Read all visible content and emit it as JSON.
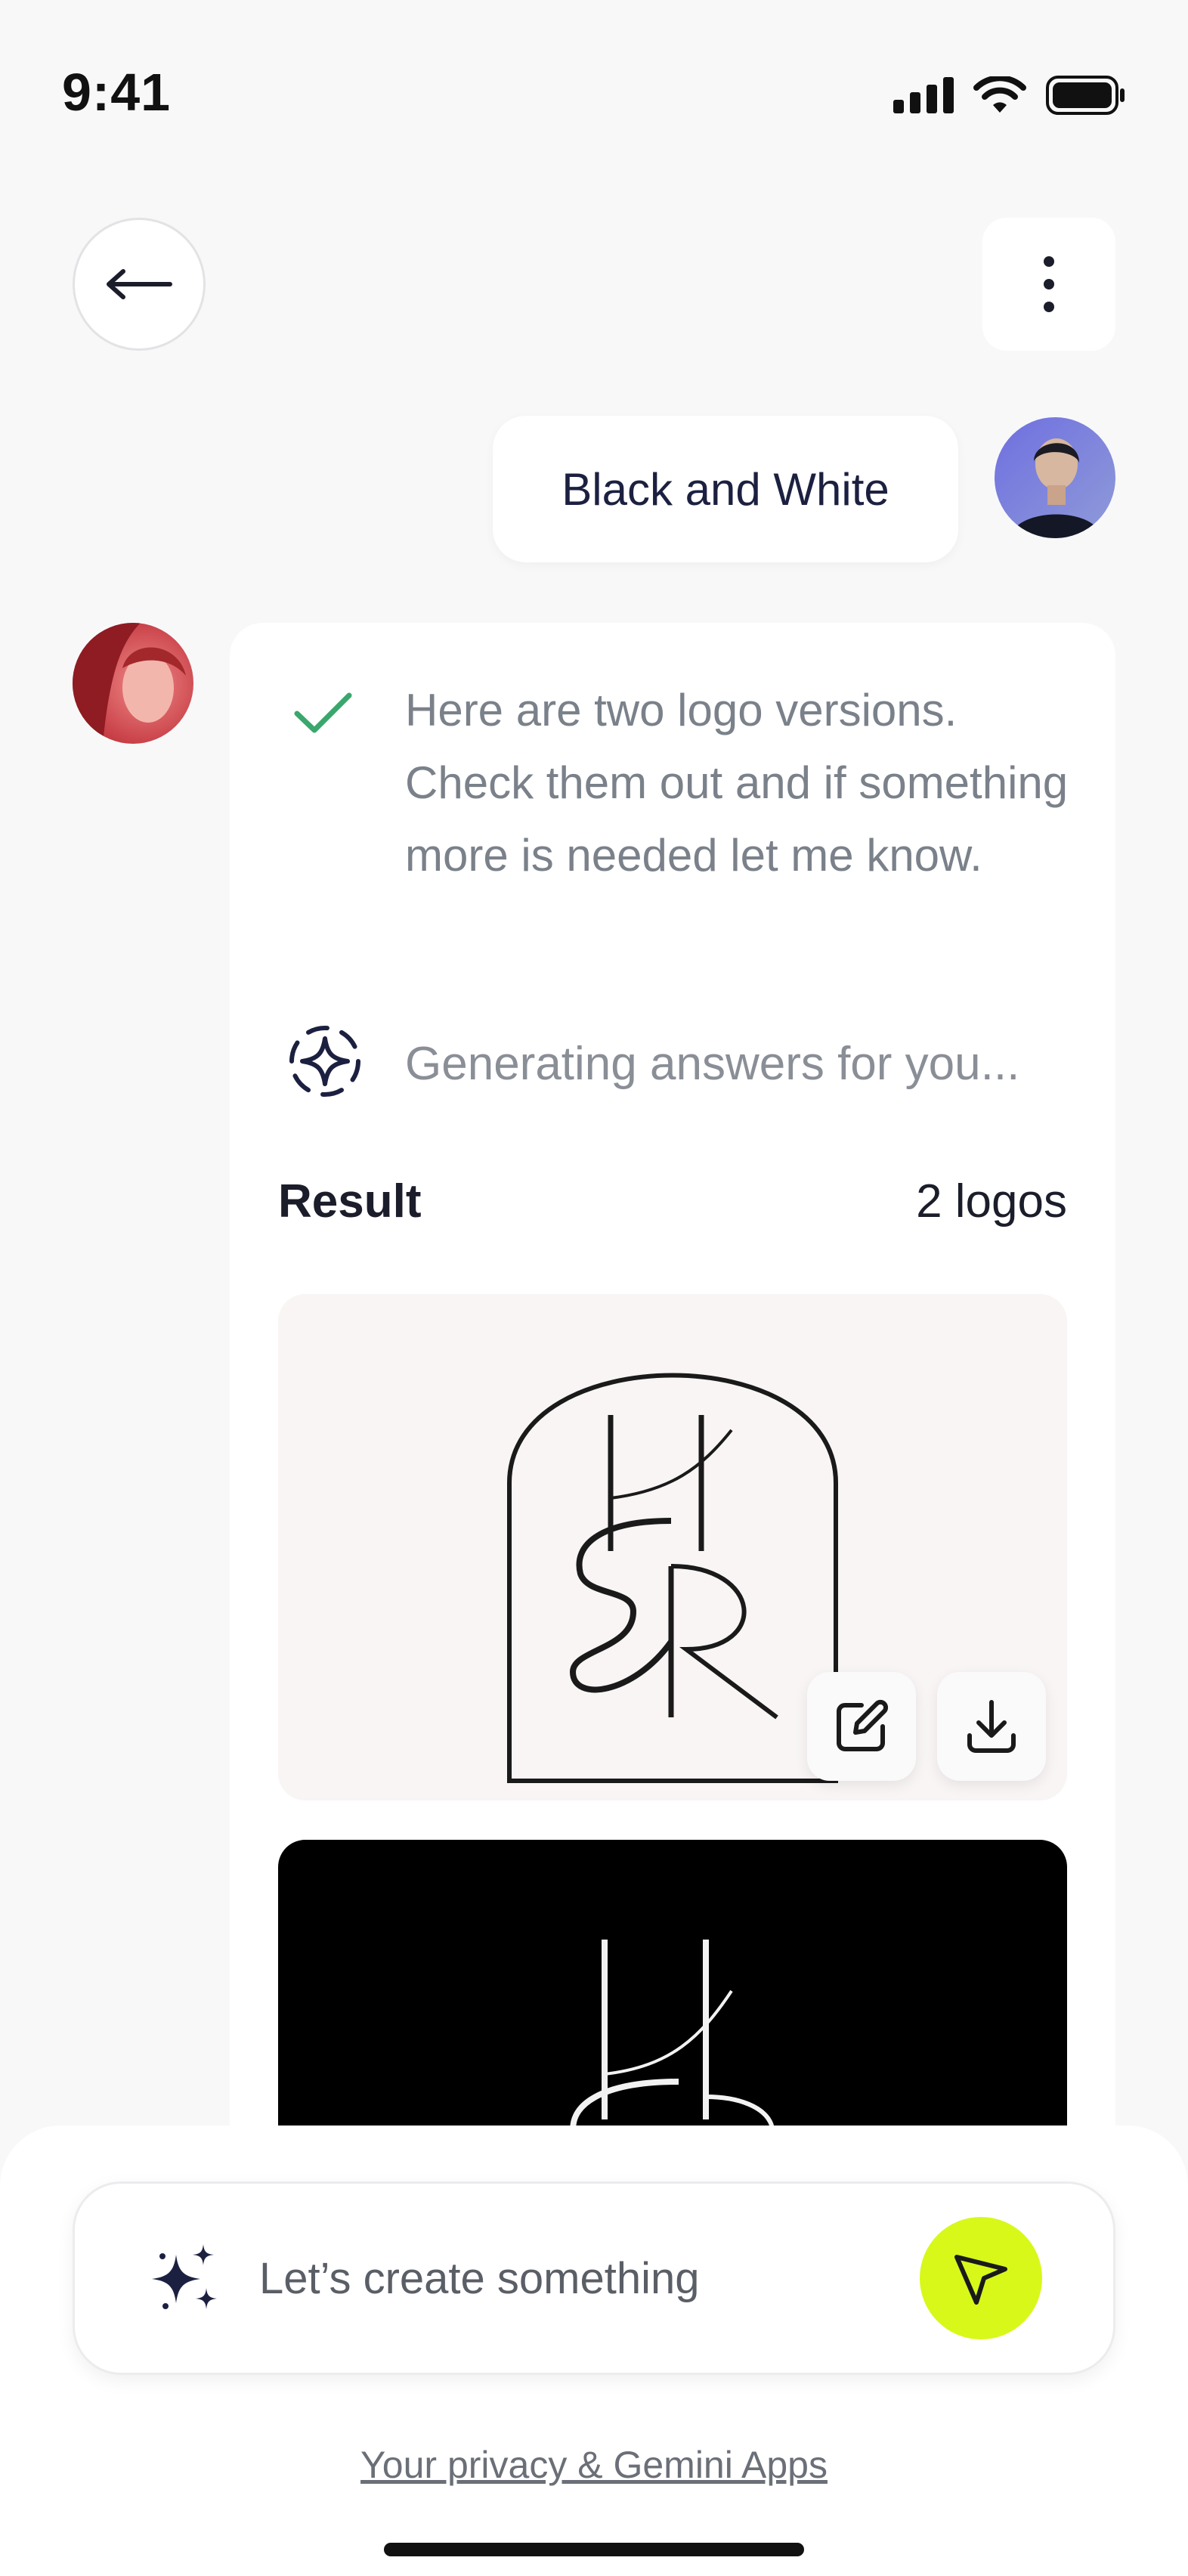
{
  "status_bar": {
    "time": "9:41",
    "icons": [
      "signal-icon",
      "wifi-icon",
      "battery-icon"
    ]
  },
  "header": {
    "back_icon": "arrow-left-icon",
    "menu_icon": "more-vertical-icon"
  },
  "conversation": {
    "user_message": "Black and White",
    "assistant": {
      "status_icon": "check-icon",
      "message": "Here are two logo versions. Check them out and if something more is needed let me know.",
      "generating_text": "Generating answers for you...",
      "result_label": "Result",
      "result_count": "2 logos",
      "logos": [
        {
          "theme": "light",
          "monogram_top": "H",
          "monogram_bottom": "&R"
        },
        {
          "theme": "dark",
          "monogram_top": "H",
          "monogram_bottom": "&R"
        }
      ],
      "actions": [
        "edit-icon",
        "download-icon"
      ]
    }
  },
  "composer": {
    "placeholder": "Let’s create something",
    "send_icon": "send-icon"
  },
  "footer": {
    "privacy_link": "Your privacy & Gemini Apps"
  },
  "colors": {
    "accent": "#d8f81a",
    "success": "#3aa76d",
    "text_primary": "#1c2040",
    "text_muted": "#7a818a",
    "background": "#f8f8f9"
  }
}
